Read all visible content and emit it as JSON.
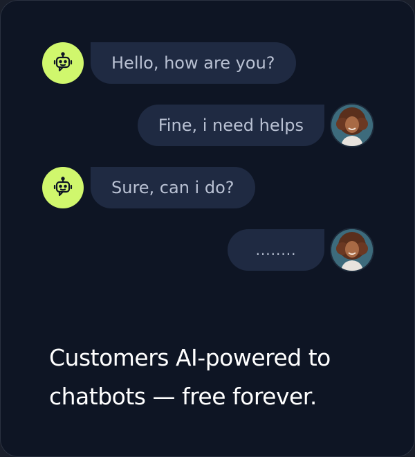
{
  "chat": {
    "messages": [
      {
        "sender": "bot",
        "text": "Hello, how are you?"
      },
      {
        "sender": "user",
        "text": "Fine, i need helps"
      },
      {
        "sender": "bot",
        "text": "Sure, can i do?"
      },
      {
        "sender": "user",
        "text": "........"
      }
    ]
  },
  "headline": {
    "line1": "Customers AI-powered to",
    "line2": "chatbots — free forever."
  },
  "colors": {
    "card_background": "#0e1524",
    "bubble_background": "#1f2a42",
    "bot_avatar": "#d0f76d",
    "bubble_text": "#b9c1d3",
    "headline_text": "#ffffff"
  },
  "icons": {
    "bot_avatar": "robot-icon",
    "user_avatar": "user-photo-avatar"
  }
}
